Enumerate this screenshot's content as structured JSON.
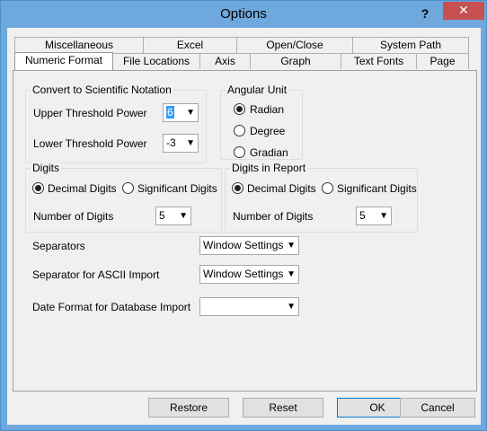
{
  "window": {
    "title": "Options",
    "help_glyph": "?",
    "close_glyph": "✕"
  },
  "tabs": {
    "row1": [
      "Miscellaneous",
      "Excel",
      "Open/Close",
      "System Path"
    ],
    "row2": [
      "Numeric Format",
      "File Locations",
      "Axis",
      "Graph",
      "Text Fonts",
      "Page"
    ],
    "active": "Numeric Format"
  },
  "scientific": {
    "title": "Convert to Scientific Notation",
    "upper_label": "Upper Threshold Power",
    "upper_value": "6",
    "lower_label": "Lower Threshold Power",
    "lower_value": "-3"
  },
  "angular": {
    "title": "Angular Unit",
    "options": [
      "Radian",
      "Degree",
      "Gradian"
    ],
    "selected": "Radian"
  },
  "digits": {
    "title": "Digits",
    "option_decimal": "Decimal Digits",
    "option_significant": "Significant Digits",
    "selected": "Decimal Digits",
    "count_label": "Number of Digits",
    "count_value": "5"
  },
  "digits_report": {
    "title": "Digits in Report",
    "option_decimal": "Decimal Digits",
    "option_significant": "Significant Digits",
    "selected": "Decimal Digits",
    "count_label": "Number of Digits",
    "count_value": "5"
  },
  "separators": {
    "label": "Separators",
    "value": "Window Settings",
    "ascii_label": "Separator for ASCII Import",
    "ascii_value": "Window Settings",
    "date_label": "Date Format for Database Import",
    "date_value": ""
  },
  "buttons": {
    "restore": "Restore",
    "reset": "Reset",
    "ok": "OK",
    "cancel": "Cancel"
  }
}
